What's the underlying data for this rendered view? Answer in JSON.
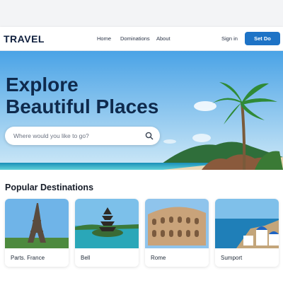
{
  "brand": {
    "logo": "TRAVEL"
  },
  "nav": {
    "links": [
      "Home",
      "Dominations",
      "About"
    ],
    "sign_in": "Sign in",
    "cta": "Set Do"
  },
  "hero": {
    "title_line1": "Explore",
    "title_line2": "Beautiful Places",
    "search_placeholder": "Where would you like to go?"
  },
  "section": {
    "title": "Popular Destinations",
    "cards": [
      {
        "label": "Parts. France",
        "image": "eiffel-tower"
      },
      {
        "label": "Bell",
        "image": "bali-temple"
      },
      {
        "label": "Rome",
        "image": "colosseum"
      },
      {
        "label": "Sumport",
        "image": "santorini"
      }
    ]
  },
  "colors": {
    "brand": "#0f1f3d",
    "accent": "#1e73c6",
    "heading": "#0f2a4d"
  }
}
